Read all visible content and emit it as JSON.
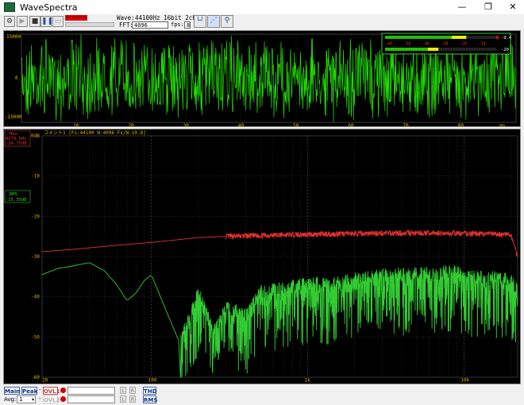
{
  "window": {
    "title": "WaveSpectra",
    "minimize_glyph": "—",
    "maximize_glyph": "❐",
    "close_glyph": "✕"
  },
  "toolbar": {
    "rec_indicator": "Recording",
    "wave_label": "Wave:",
    "wave_value": "44100Hz 16bit 2ch",
    "fft_label": "FFT:",
    "fft_value": "4096 Hanning",
    "fps_label": "fps:",
    "fps_value": "8"
  },
  "wave": {
    "y_top": "15000",
    "y_mid": "0",
    "y_bottom": "-15000",
    "x_ticks": [
      "10",
      "20",
      "30",
      "40",
      "50",
      "60",
      "70",
      "80"
    ],
    "x_unit": "ms",
    "meter_scale": [
      "-60",
      "-50",
      "-40",
      "-30",
      "-20",
      "-10"
    ],
    "meter_peak_top": "-9.4",
    "meter_peak_bottom": "-20",
    "meter_top_level": 0.73,
    "meter_bottom_level": 0.48,
    "color_wave": "#22dd00"
  },
  "fft": {
    "comment": "コメント1 [Fs:44100 N:4096 Fs/N:10.8]",
    "max_label": "Max",
    "max_freq": "8279.5Hz",
    "max_db": "-34.75dB",
    "rms_label": "RMS",
    "rms_db": "-15.35dB",
    "y_ticks": [
      "0dB",
      "-10",
      "-20",
      "-30",
      "-40",
      "-50",
      "-60"
    ],
    "x_major": [
      "20",
      "100",
      "1k",
      "10k"
    ],
    "color_red": "#e03030",
    "color_green": "#33cc33"
  },
  "chart_data": {
    "type": "line",
    "title": "",
    "xlabel": "",
    "ylabel": "",
    "x_scale": "log",
    "xlim": [
      20,
      22050
    ],
    "ylim": [
      -60,
      0
    ],
    "grid": true,
    "series": [
      {
        "name": "",
        "x": [
          20,
          30,
          50,
          70,
          100,
          150,
          200,
          300,
          500,
          700,
          1000,
          1500,
          2000,
          3000,
          5000,
          7000,
          10000,
          15000,
          20000,
          22050
        ],
        "y": [
          -28.8,
          -28.3,
          -27.5,
          -27,
          -26.5,
          -25.8,
          -25.3,
          -25,
          -24.8,
          -24.6,
          -24.5,
          -24.4,
          -24.3,
          -24.2,
          -24.2,
          -24.2,
          -24.3,
          -24.4,
          -24.6,
          -30
        ]
      },
      {
        "name": "",
        "x": [
          20,
          25,
          30,
          40,
          50,
          60,
          70,
          80,
          90,
          100,
          120,
          150,
          170,
          200,
          250,
          300,
          400,
          500,
          700,
          1000,
          1500,
          2000,
          3000,
          5000,
          7000,
          8279.5,
          10000,
          15000,
          20000,
          22050
        ],
        "y": [
          -34.5,
          -33,
          -32.5,
          -31.5,
          -33.5,
          -37,
          -41,
          -39,
          -36,
          -34.5,
          -42,
          -51,
          -48,
          -40,
          -50,
          -44,
          -46,
          -40,
          -39,
          -38,
          -38,
          -37,
          -36,
          -35.5,
          -35.5,
          -34.75,
          -36,
          -36.5,
          -37,
          -40
        ]
      }
    ]
  },
  "bottom": {
    "main": "Main",
    "peak": "Peak",
    "dash": "-",
    "ovl1": "OVL1",
    "ovl2": "OVL2",
    "avg_label": "Avg:",
    "avg_value": "1",
    "l": "L",
    "r": "R",
    "thd": "THD",
    "rms": "RMS"
  }
}
